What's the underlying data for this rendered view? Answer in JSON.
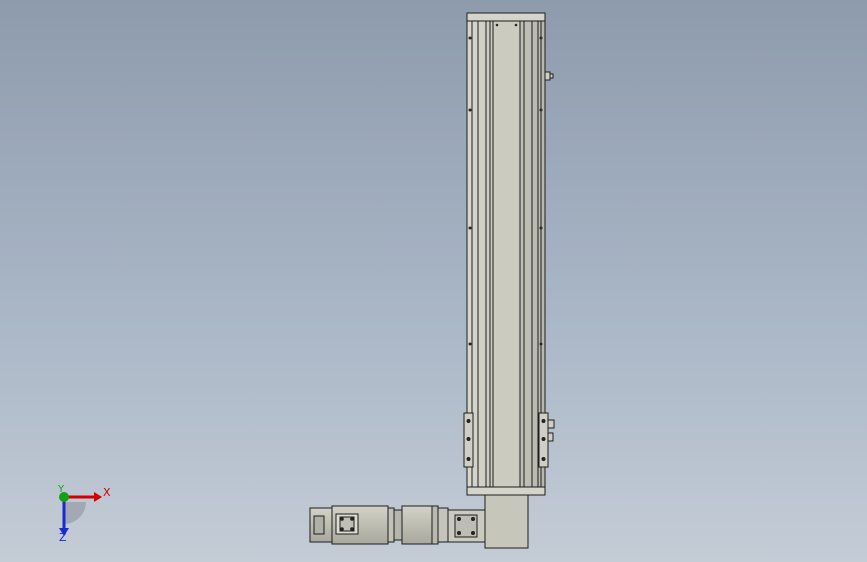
{
  "view": {
    "background_top": "#8e9bac",
    "background_bottom": "#c4ccd6"
  },
  "triad": {
    "x_label": "X",
    "y_label": "Y",
    "z_label": "Z",
    "x_color": "#d40000",
    "y_color": "#16a016",
    "z_color": "#1a2ad0"
  },
  "model": {
    "body_color": "#c9c9bf",
    "edge_color": "#1e1e1e"
  }
}
